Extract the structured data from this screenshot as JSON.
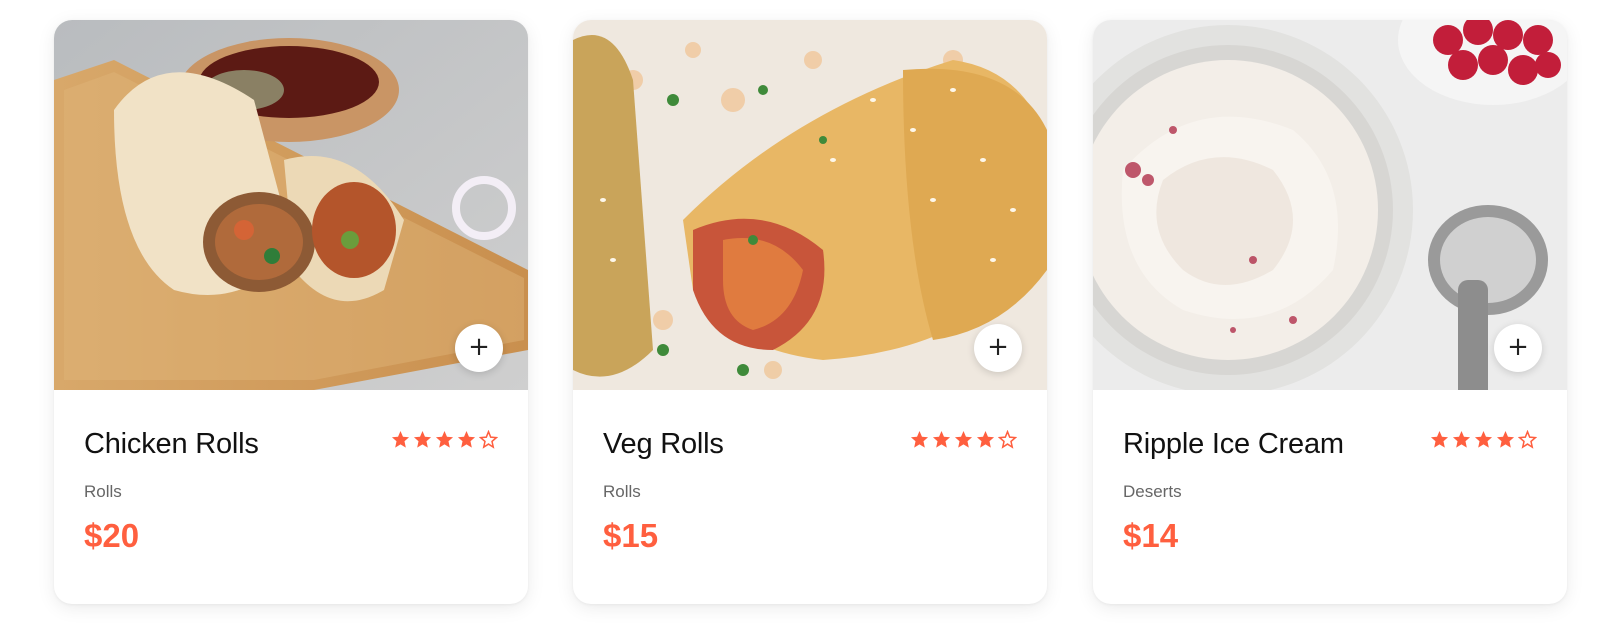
{
  "theme": {
    "accent": "#ff5f3f",
    "text": "#111111",
    "muted": "#666666",
    "card_bg": "#ffffff"
  },
  "products": [
    {
      "name": "Chicken Rolls",
      "category": "Rolls",
      "price": "$20",
      "rating": 4,
      "rating_max": 5,
      "image_icon": "chicken-rolls-photo",
      "add_icon": "plus-icon",
      "add_label": "+"
    },
    {
      "name": "Veg Rolls",
      "category": "Rolls",
      "price": "$15",
      "rating": 4,
      "rating_max": 5,
      "image_icon": "veg-rolls-photo",
      "add_icon": "plus-icon",
      "add_label": "+"
    },
    {
      "name": "Ripple Ice Cream",
      "category": "Deserts",
      "price": "$14",
      "rating": 4,
      "rating_max": 5,
      "image_icon": "ripple-ice-cream-photo",
      "add_icon": "plus-icon",
      "add_label": "+"
    }
  ]
}
